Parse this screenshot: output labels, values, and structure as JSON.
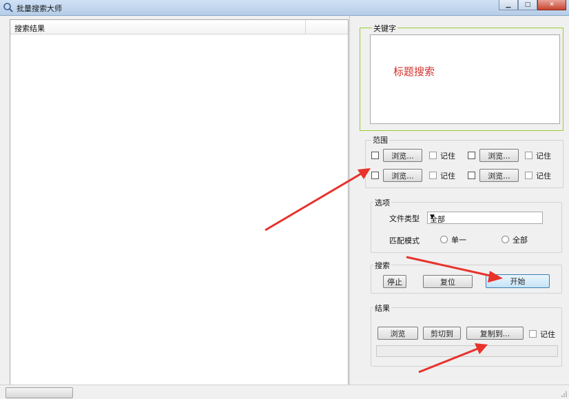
{
  "window": {
    "title": "批量搜索大师"
  },
  "results": {
    "header": "搜索结果"
  },
  "keyword": {
    "label": "关键字",
    "hint": "标题搜索"
  },
  "scope": {
    "label": "范围",
    "browse_label": "浏览...",
    "remember_label": "记住"
  },
  "options": {
    "label": "选项",
    "file_type_label": "文件类型",
    "file_type_value": "全部",
    "match_mode_label": "匹配模式",
    "match_single": "单一",
    "match_all": "全部"
  },
  "search": {
    "label": "搜索",
    "stop": "停止",
    "reset": "复位",
    "start": "开始"
  },
  "result_group": {
    "label": "结果",
    "browse": "浏览",
    "cut_to": "剪切到",
    "copy_to": "复制到...",
    "remember": "记住"
  },
  "colors": {
    "annotation_arrow": "#e8322c",
    "keyword_border": "#9acd32",
    "hint_text": "#d0332f"
  }
}
